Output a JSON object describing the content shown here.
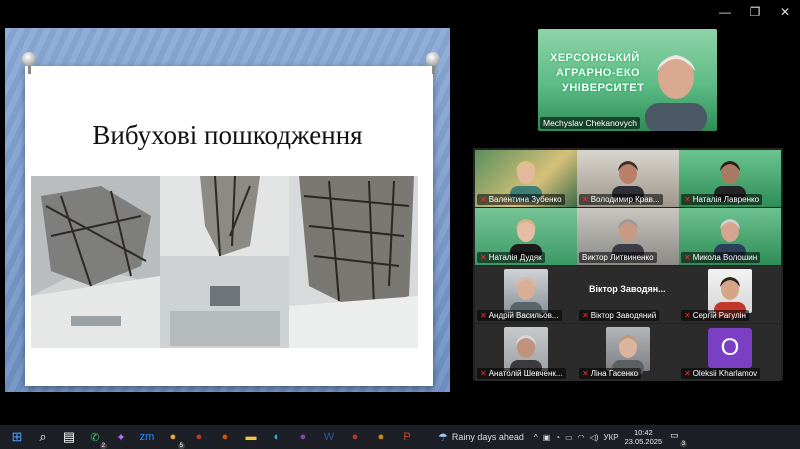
{
  "window": {
    "minimize_glyph": "—",
    "restore_glyph": "❐",
    "close_glyph": "✕"
  },
  "slide": {
    "title": "Вибухові пошкодження"
  },
  "speaker": {
    "name": "Mechyslav Chekanovych",
    "wall_text": [
      "ХЕРСОНСЬКИЙ",
      "АГРАРНО-ЕКО",
      "УНІВЕРСИТЕТ"
    ]
  },
  "gallery": {
    "participants": [
      {
        "name": "Валентина Зубенко",
        "muted": true,
        "style": "woman-blonde"
      },
      {
        "name": "Володимир Крав...",
        "muted": true,
        "style": "man-dark"
      },
      {
        "name": "Наталія Лавренко",
        "muted": true,
        "style": "green-wall"
      },
      {
        "name": "Наталія Дудяк",
        "muted": true,
        "style": "woman-green"
      },
      {
        "name": "Виктор Литвиненко",
        "muted": false,
        "style": "man-older"
      },
      {
        "name": "Микола Волошин",
        "muted": true,
        "style": "man-green"
      },
      {
        "name": "Андрій Васильов...",
        "muted": true,
        "style": "man-bald"
      },
      {
        "name": "Віктор Заводяний",
        "muted": true,
        "style": "name-only",
        "title": "Віктор Заводян..."
      },
      {
        "name": "Сергій Рагулін",
        "muted": true,
        "style": "man-young"
      },
      {
        "name": "Анатолій Шевченк...",
        "muted": true,
        "style": "man-grey"
      },
      {
        "name": "Ліна Гасенко",
        "muted": true,
        "style": "woman-small"
      },
      {
        "name": "Oleksii Kharlamov",
        "muted": true,
        "style": "avatar",
        "initial": "O"
      }
    ]
  },
  "taskbar": {
    "icons": [
      {
        "name": "windows-start-icon",
        "glyph": "⊞",
        "color": "#4aa3ff"
      },
      {
        "name": "search-icon",
        "glyph": "⌕",
        "color": "#ffffff"
      },
      {
        "name": "task-view-icon",
        "glyph": "▤",
        "color": "#ffffff"
      },
      {
        "name": "whatsapp-icon",
        "glyph": "✆",
        "color": "#25d366",
        "badge": "2"
      },
      {
        "name": "copilot-icon",
        "glyph": "✦",
        "color": "#c86bff"
      },
      {
        "name": "zoom-icon",
        "glyph": "zm",
        "color": "#2d8cff"
      },
      {
        "name": "chrome-icon",
        "glyph": "●",
        "color": "#e8a33c",
        "badge": "5"
      },
      {
        "name": "chrome-profile-icon",
        "glyph": "●",
        "color": "#c0392b",
        "badge": ""
      },
      {
        "name": "chrome-profile-2-icon",
        "glyph": "●",
        "color": "#d35400",
        "badge": ""
      },
      {
        "name": "file-explorer-icon",
        "glyph": "▬",
        "color": "#f5c542"
      },
      {
        "name": "edge-icon",
        "glyph": "◐",
        "color": "#2fb4e9"
      },
      {
        "name": "chrome-profile-3-icon",
        "glyph": "●",
        "color": "#8e44ad",
        "badge": ""
      },
      {
        "name": "word-icon",
        "glyph": "W",
        "color": "#2b579a"
      },
      {
        "name": "chrome-profile-4-icon",
        "glyph": "●",
        "color": "#b03a2e",
        "badge": ""
      },
      {
        "name": "chrome-profile-5-icon",
        "glyph": "●",
        "color": "#d68910",
        "badge": ""
      },
      {
        "name": "powerpoint-icon",
        "glyph": "P",
        "color": "#d24726"
      }
    ],
    "weather": "Rainy days ahead",
    "tray_chevron": "^",
    "language": "УКР",
    "time": "10:42",
    "date": "23.05.2025",
    "notification_count": "3"
  }
}
